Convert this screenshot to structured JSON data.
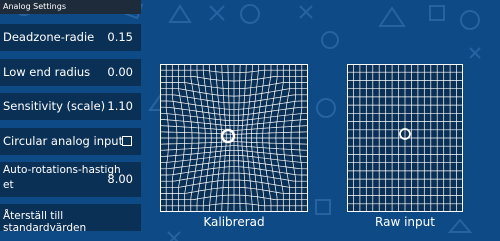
{
  "title": "Analog Settings",
  "settings": [
    {
      "label": "Deadzone-radie",
      "value": "0.15"
    },
    {
      "label": "Low end radius",
      "value": "0.00"
    },
    {
      "label": "Sensitivity (scale)",
      "value": "1.10"
    },
    {
      "label": "Circular analog input",
      "checked": false
    },
    {
      "label_line1": "Auto-rotations-hastigh",
      "label_line2": "et",
      "value": "8.00"
    },
    {
      "label": "Återställ till standardvärden"
    }
  ],
  "plots": {
    "calibrated_label": "Kalibrerad",
    "raw_label": "Raw input"
  },
  "colors": {
    "background": "#0e4a85",
    "row": "#0b3056",
    "header": "#1d2b3a"
  }
}
